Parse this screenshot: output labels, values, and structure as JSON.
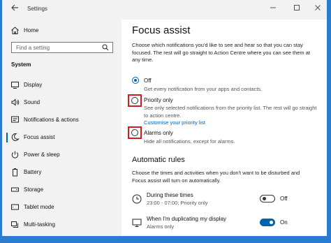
{
  "window": {
    "title": "Settings",
    "back_icon": "arrow-left-icon",
    "controls": [
      "minimize-icon",
      "maximize-icon",
      "close-icon"
    ]
  },
  "sidebar": {
    "home_label": "Home",
    "search_placeholder": "Find a setting",
    "section_label": "System",
    "items": [
      {
        "label": "Display",
        "icon": "display-icon"
      },
      {
        "label": "Sound",
        "icon": "speaker-icon"
      },
      {
        "label": "Notifications & actions",
        "icon": "notifications-icon"
      },
      {
        "label": "Focus assist",
        "icon": "moon-icon",
        "active": true
      },
      {
        "label": "Power & sleep",
        "icon": "power-icon"
      },
      {
        "label": "Battery",
        "icon": "battery-icon"
      },
      {
        "label": "Storage",
        "icon": "storage-icon"
      },
      {
        "label": "Tablet mode",
        "icon": "tablet-icon"
      },
      {
        "label": "Multi-tasking",
        "icon": "multitasking-icon"
      }
    ]
  },
  "main": {
    "title": "Focus assist",
    "description": "Choose which notifications you'd like to see and hear so that you can stay focused. The rest will go straight to Action Centre where you can see them at any time.",
    "options": [
      {
        "title": "Off",
        "subtitle": "Get every notification from your apps and contacts.",
        "selected": true
      },
      {
        "title": "Priority only",
        "subtitle": "See only selected notifications from the priority list. The rest will go straight to action centre.",
        "link": "Customise your priority list",
        "selected": false
      },
      {
        "title": "Alarms only",
        "subtitle": "Hide all notifications, except for alarms.",
        "selected": false
      }
    ],
    "automatic_rules": {
      "title": "Automatic rules",
      "description": "Choose the times and activities when you don't want to be disturbed and Focus assist will turn on automatically.",
      "rules": [
        {
          "title": "During these times",
          "subtitle": "23:00 - 07:00; Priority only",
          "state": "Off",
          "icon": "clock-icon"
        },
        {
          "title": "When I'm duplicating my display",
          "subtitle": "Alarms only",
          "state": "On",
          "icon": "monitor-icon"
        }
      ]
    }
  },
  "colors": {
    "accent": "#0063b1",
    "highlight": "#d41920",
    "desktop": "#2b7bd0"
  }
}
